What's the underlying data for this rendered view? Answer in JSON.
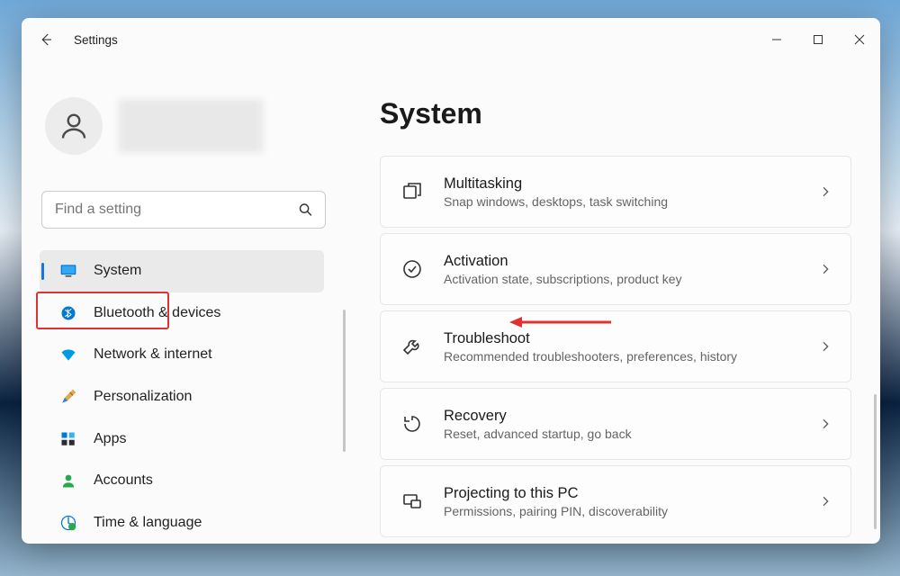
{
  "window": {
    "title": "Settings"
  },
  "search": {
    "placeholder": "Find a setting"
  },
  "nav": {
    "items": [
      {
        "label": "System"
      },
      {
        "label": "Bluetooth & devices"
      },
      {
        "label": "Network & internet"
      },
      {
        "label": "Personalization"
      },
      {
        "label": "Apps"
      },
      {
        "label": "Accounts"
      },
      {
        "label": "Time & language"
      }
    ]
  },
  "page": {
    "title": "System"
  },
  "cards": [
    {
      "title": "Multitasking",
      "subtitle": "Snap windows, desktops, task switching"
    },
    {
      "title": "Activation",
      "subtitle": "Activation state, subscriptions, product key"
    },
    {
      "title": "Troubleshoot",
      "subtitle": "Recommended troubleshooters, preferences, history"
    },
    {
      "title": "Recovery",
      "subtitle": "Reset, advanced startup, go back"
    },
    {
      "title": "Projecting to this PC",
      "subtitle": "Permissions, pairing PIN, discoverability"
    }
  ]
}
